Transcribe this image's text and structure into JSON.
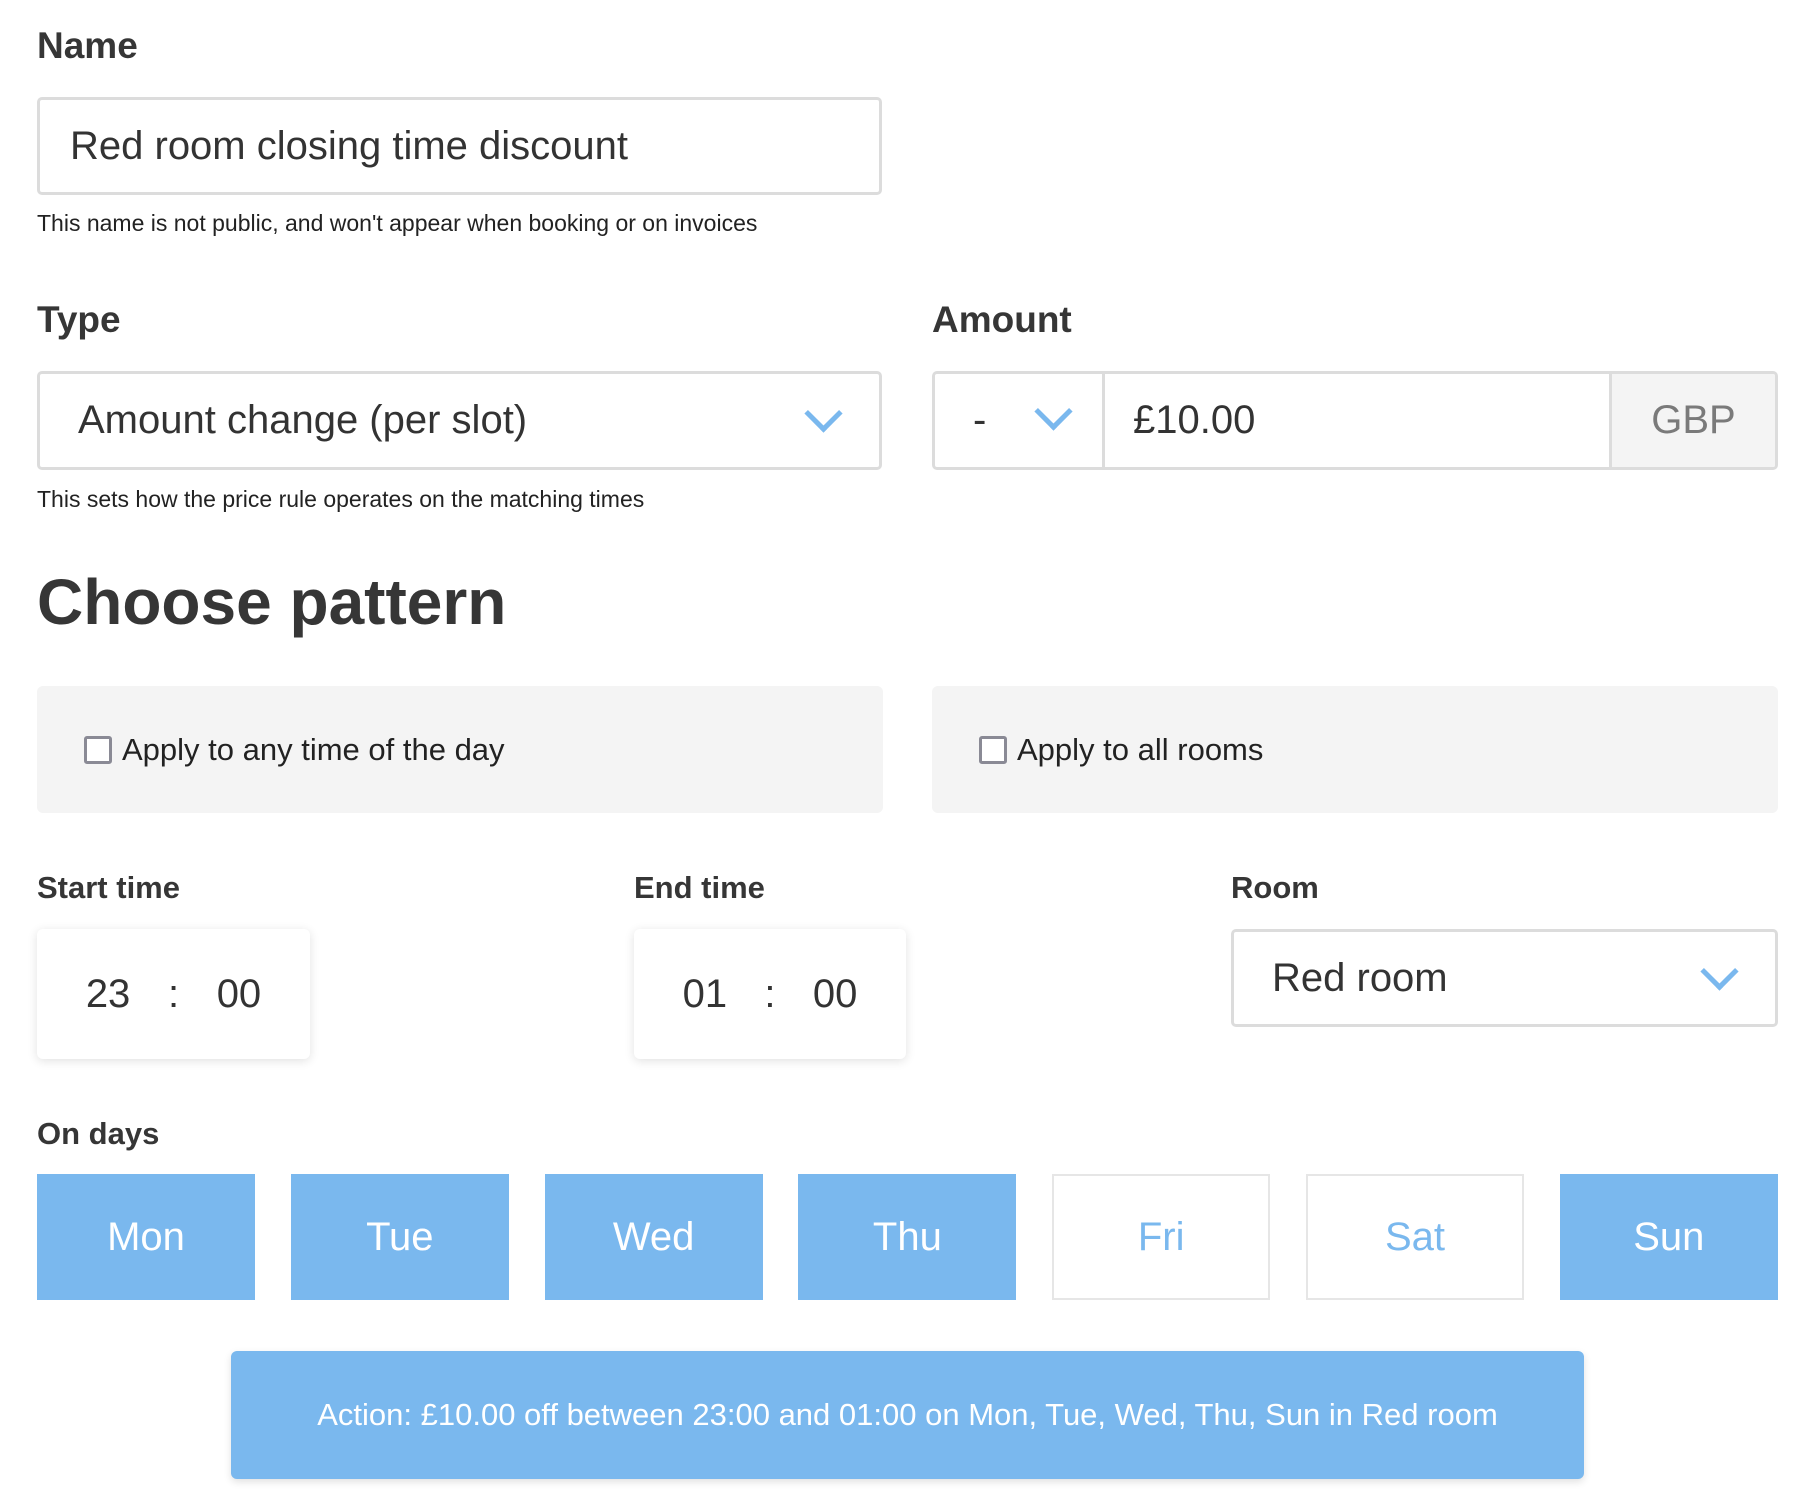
{
  "name": {
    "label": "Name",
    "value": "Red room closing time discount",
    "hint": "This name is not public, and won't appear when booking or on invoices"
  },
  "type": {
    "label": "Type",
    "value": "Amount change (per slot)",
    "hint": "This sets how the price rule operates on the matching times",
    "icon": "chevron-down-icon"
  },
  "amount": {
    "label": "Amount",
    "sign": "-",
    "value": "£10.00",
    "currency": "GBP"
  },
  "pattern": {
    "heading": "Choose pattern",
    "any_time": {
      "label": "Apply to any time of the day",
      "checked": false
    },
    "all_rooms": {
      "label": "Apply to all rooms",
      "checked": false
    }
  },
  "start_time": {
    "label": "Start time",
    "hour": "23",
    "sep": ":",
    "minute": "00"
  },
  "end_time": {
    "label": "End time",
    "hour": "01",
    "sep": ":",
    "minute": "00"
  },
  "room": {
    "label": "Room",
    "value": "Red room"
  },
  "days": {
    "label": "On days",
    "items": [
      {
        "label": "Mon",
        "selected": true
      },
      {
        "label": "Tue",
        "selected": true
      },
      {
        "label": "Wed",
        "selected": true
      },
      {
        "label": "Thu",
        "selected": true
      },
      {
        "label": "Fri",
        "selected": false
      },
      {
        "label": "Sat",
        "selected": false
      },
      {
        "label": "Sun",
        "selected": true
      }
    ]
  },
  "action": {
    "text": "Action: £10.00 off between 23:00 and 01:00 on Mon, Tue, Wed, Thu, Sun in Red room"
  },
  "colors": {
    "accent": "#7ab8ee",
    "border": "#dcdcdc",
    "panel": "#f4f4f4"
  }
}
